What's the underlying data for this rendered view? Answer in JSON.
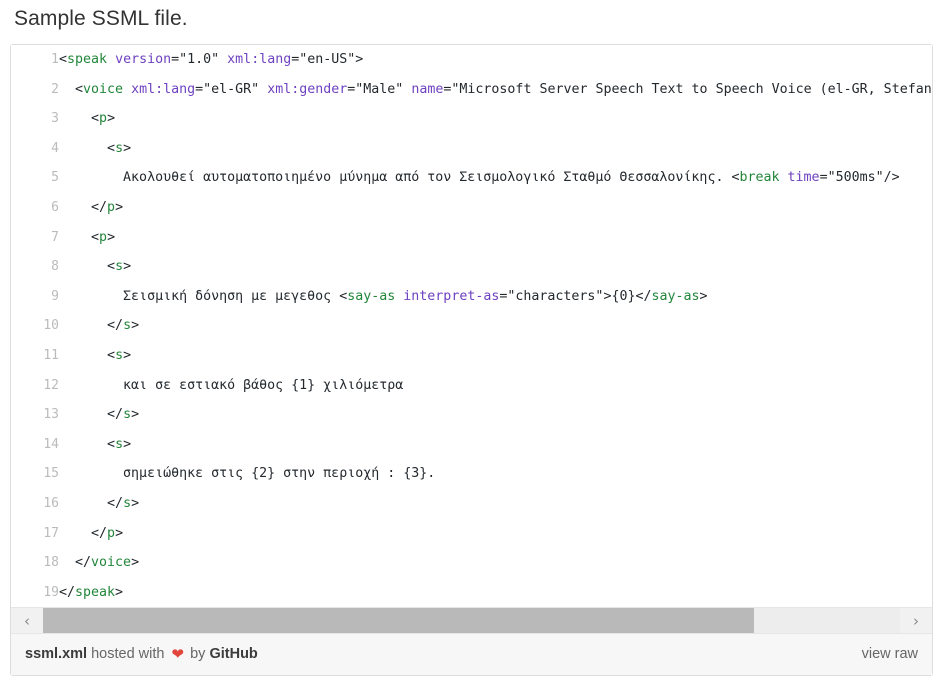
{
  "page": {
    "title": "Sample SSML file."
  },
  "colors": {
    "tag": "#22863a",
    "attribute": "#6f42c1",
    "text": "#24292e",
    "line_number": "#babbbc",
    "border": "#dddddd",
    "footer_bg": "#f7f7f7",
    "scroll_thumb": "#b9b9b9",
    "heart": "#e2453c"
  },
  "code": {
    "language": "xml",
    "line_count": 19,
    "lines": [
      {
        "n": "1",
        "indent": 0,
        "tokens": [
          {
            "t": "punct",
            "v": "<"
          },
          {
            "t": "tag",
            "v": "speak"
          },
          {
            "t": "punct",
            "v": " "
          },
          {
            "t": "attr",
            "v": "version"
          },
          {
            "t": "punct",
            "v": "="
          },
          {
            "t": "str",
            "v": "\"1.0\""
          },
          {
            "t": "punct",
            "v": " "
          },
          {
            "t": "attr",
            "v": "xml:lang"
          },
          {
            "t": "punct",
            "v": "="
          },
          {
            "t": "str",
            "v": "\"en-US\""
          },
          {
            "t": "punct",
            "v": ">"
          }
        ]
      },
      {
        "n": "2",
        "indent": 1,
        "tokens": [
          {
            "t": "punct",
            "v": "<"
          },
          {
            "t": "tag",
            "v": "voice"
          },
          {
            "t": "punct",
            "v": " "
          },
          {
            "t": "attr",
            "v": "xml:lang"
          },
          {
            "t": "punct",
            "v": "="
          },
          {
            "t": "str",
            "v": "\"el-GR\""
          },
          {
            "t": "punct",
            "v": " "
          },
          {
            "t": "attr",
            "v": "xml:gender"
          },
          {
            "t": "punct",
            "v": "="
          },
          {
            "t": "str",
            "v": "\"Male\""
          },
          {
            "t": "punct",
            "v": " "
          },
          {
            "t": "attr",
            "v": "name"
          },
          {
            "t": "punct",
            "v": "="
          },
          {
            "t": "str",
            "v": "\"Microsoft Server Speech Text to Speech Voice (el-GR, Stefanos)\""
          },
          {
            "t": "punct",
            "v": ">"
          }
        ]
      },
      {
        "n": "3",
        "indent": 2,
        "tokens": [
          {
            "t": "punct",
            "v": "<"
          },
          {
            "t": "tag",
            "v": "p"
          },
          {
            "t": "punct",
            "v": ">"
          }
        ]
      },
      {
        "n": "4",
        "indent": 3,
        "tokens": [
          {
            "t": "punct",
            "v": "<"
          },
          {
            "t": "tag",
            "v": "s"
          },
          {
            "t": "punct",
            "v": ">"
          }
        ]
      },
      {
        "n": "5",
        "indent": 4,
        "tokens": [
          {
            "t": "txt",
            "v": "Ακολουθεί αυτοματοποιημένο μύνημα από τον Σεισμολογικό Σταθμό Θεσσαλονίκης. "
          },
          {
            "t": "punct",
            "v": "<"
          },
          {
            "t": "tag",
            "v": "break"
          },
          {
            "t": "punct",
            "v": " "
          },
          {
            "t": "attr",
            "v": "time"
          },
          {
            "t": "punct",
            "v": "="
          },
          {
            "t": "str",
            "v": "\"500ms\""
          },
          {
            "t": "punct",
            "v": "/>"
          }
        ]
      },
      {
        "n": "6",
        "indent": 2,
        "tokens": [
          {
            "t": "punct",
            "v": "</"
          },
          {
            "t": "tag",
            "v": "p"
          },
          {
            "t": "punct",
            "v": ">"
          }
        ]
      },
      {
        "n": "7",
        "indent": 2,
        "tokens": [
          {
            "t": "punct",
            "v": "<"
          },
          {
            "t": "tag",
            "v": "p"
          },
          {
            "t": "punct",
            "v": ">"
          }
        ]
      },
      {
        "n": "8",
        "indent": 3,
        "tokens": [
          {
            "t": "punct",
            "v": "<"
          },
          {
            "t": "tag",
            "v": "s"
          },
          {
            "t": "punct",
            "v": ">"
          }
        ]
      },
      {
        "n": "9",
        "indent": 4,
        "tokens": [
          {
            "t": "txt",
            "v": "Σεισμική δόνηση με μεγεθος "
          },
          {
            "t": "punct",
            "v": "<"
          },
          {
            "t": "tag",
            "v": "say-as"
          },
          {
            "t": "punct",
            "v": " "
          },
          {
            "t": "attr",
            "v": "interpret-as"
          },
          {
            "t": "punct",
            "v": "="
          },
          {
            "t": "str",
            "v": "\"characters\""
          },
          {
            "t": "punct",
            "v": ">{0}</"
          },
          {
            "t": "tag",
            "v": "say-as"
          },
          {
            "t": "punct",
            "v": ">"
          }
        ]
      },
      {
        "n": "10",
        "indent": 3,
        "tokens": [
          {
            "t": "punct",
            "v": "</"
          },
          {
            "t": "tag",
            "v": "s"
          },
          {
            "t": "punct",
            "v": ">"
          }
        ]
      },
      {
        "n": "11",
        "indent": 3,
        "tokens": [
          {
            "t": "punct",
            "v": "<"
          },
          {
            "t": "tag",
            "v": "s"
          },
          {
            "t": "punct",
            "v": ">"
          }
        ]
      },
      {
        "n": "12",
        "indent": 4,
        "tokens": [
          {
            "t": "txt",
            "v": "και σε εστιακό βάθος {1} χιλιόμετρα"
          }
        ]
      },
      {
        "n": "13",
        "indent": 3,
        "tokens": [
          {
            "t": "punct",
            "v": "</"
          },
          {
            "t": "tag",
            "v": "s"
          },
          {
            "t": "punct",
            "v": ">"
          }
        ]
      },
      {
        "n": "14",
        "indent": 3,
        "tokens": [
          {
            "t": "punct",
            "v": "<"
          },
          {
            "t": "tag",
            "v": "s"
          },
          {
            "t": "punct",
            "v": ">"
          }
        ]
      },
      {
        "n": "15",
        "indent": 4,
        "tokens": [
          {
            "t": "txt",
            "v": "σημειώθηκε στις {2} στην περιοχή : {3}."
          }
        ]
      },
      {
        "n": "16",
        "indent": 3,
        "tokens": [
          {
            "t": "punct",
            "v": "</"
          },
          {
            "t": "tag",
            "v": "s"
          },
          {
            "t": "punct",
            "v": ">"
          }
        ]
      },
      {
        "n": "17",
        "indent": 2,
        "tokens": [
          {
            "t": "punct",
            "v": "</"
          },
          {
            "t": "tag",
            "v": "p"
          },
          {
            "t": "punct",
            "v": ">"
          }
        ]
      },
      {
        "n": "18",
        "indent": 1,
        "tokens": [
          {
            "t": "punct",
            "v": "</"
          },
          {
            "t": "tag",
            "v": "voice"
          },
          {
            "t": "punct",
            "v": ">"
          }
        ]
      },
      {
        "n": "19",
        "indent": 0,
        "tokens": [
          {
            "t": "punct",
            "v": "</"
          },
          {
            "t": "tag",
            "v": "speak"
          },
          {
            "t": "punct",
            "v": ">"
          }
        ]
      }
    ]
  },
  "scrollbar": {
    "left_arrow": "‹",
    "right_arrow": "›",
    "thumb_percent": 83
  },
  "footer": {
    "filename": "ssml.xml",
    "hosted_with": "hosted with",
    "heart": "❤",
    "by": "by",
    "host": "GitHub",
    "view_raw": "view raw"
  }
}
